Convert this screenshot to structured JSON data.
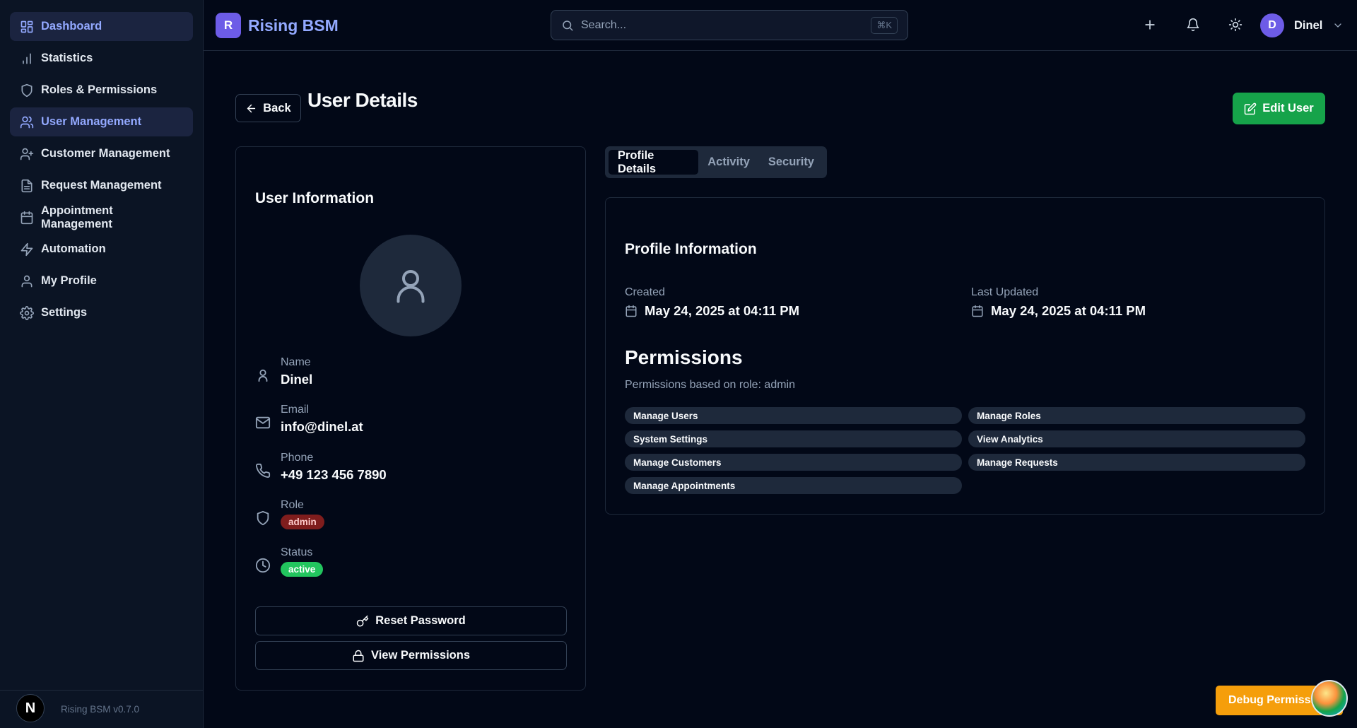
{
  "sidebar": {
    "items": [
      {
        "label": "Dashboard",
        "icon": "layout-grid-icon",
        "active": true
      },
      {
        "label": "Statistics",
        "icon": "bar-chart-icon",
        "active": false
      },
      {
        "label": "Roles & Permissions",
        "icon": "shield-icon",
        "active": false
      },
      {
        "label": "User Management",
        "icon": "users-icon",
        "active": true
      },
      {
        "label": "Customer Management",
        "icon": "user-plus-icon",
        "active": false
      },
      {
        "label": "Request Management",
        "icon": "file-text-icon",
        "active": false
      },
      {
        "label": "Appointment Management",
        "icon": "calendar-icon",
        "active": false
      },
      {
        "label": "Automation",
        "icon": "zap-icon",
        "active": false
      },
      {
        "label": "My Profile",
        "icon": "user-icon",
        "active": false
      },
      {
        "label": "Settings",
        "icon": "gear-icon",
        "active": false
      }
    ],
    "footer": {
      "badge": "N",
      "version": "Rising BSM v0.7.0"
    }
  },
  "header": {
    "logo_letter": "R",
    "app_name": "Rising BSM",
    "search_placeholder": "Search...",
    "search_shortcut": "⌘K",
    "user_initial": "D",
    "user_name": "Dinel"
  },
  "page": {
    "back_label": "Back",
    "title": "User Details",
    "edit_label": "Edit User"
  },
  "user_card": {
    "title": "User Information",
    "fields": {
      "name_label": "Name",
      "name": "Dinel",
      "email_label": "Email",
      "email": "info@dinel.at",
      "phone_label": "Phone",
      "phone": "+49 123 456 7890",
      "role_label": "Role",
      "role": "admin",
      "status_label": "Status",
      "status": "active"
    },
    "reset_password_label": "Reset Password",
    "view_permissions_label": "View Permissions"
  },
  "tabs": [
    "Profile Details",
    "Activity",
    "Security"
  ],
  "profile": {
    "title": "Profile Information",
    "created_label": "Created",
    "created": "May 24, 2025 at 04:11 PM",
    "updated_label": "Last Updated",
    "updated": "May 24, 2025 at 04:11 PM",
    "permissions_title": "Permissions",
    "permissions_subtitle": "Permissions based on role: admin",
    "permissions": [
      "Manage Users",
      "Manage Roles",
      "System Settings",
      "View Analytics",
      "Manage Customers",
      "Manage Requests",
      "Manage Appointments"
    ]
  },
  "debug": {
    "label": "Debug Permissions"
  },
  "colors": {
    "accent": "#93a9ff",
    "brand": "#6d5ce7",
    "success": "#16a34a",
    "danger": "#7f1d1d",
    "warning": "#f59e0b"
  }
}
